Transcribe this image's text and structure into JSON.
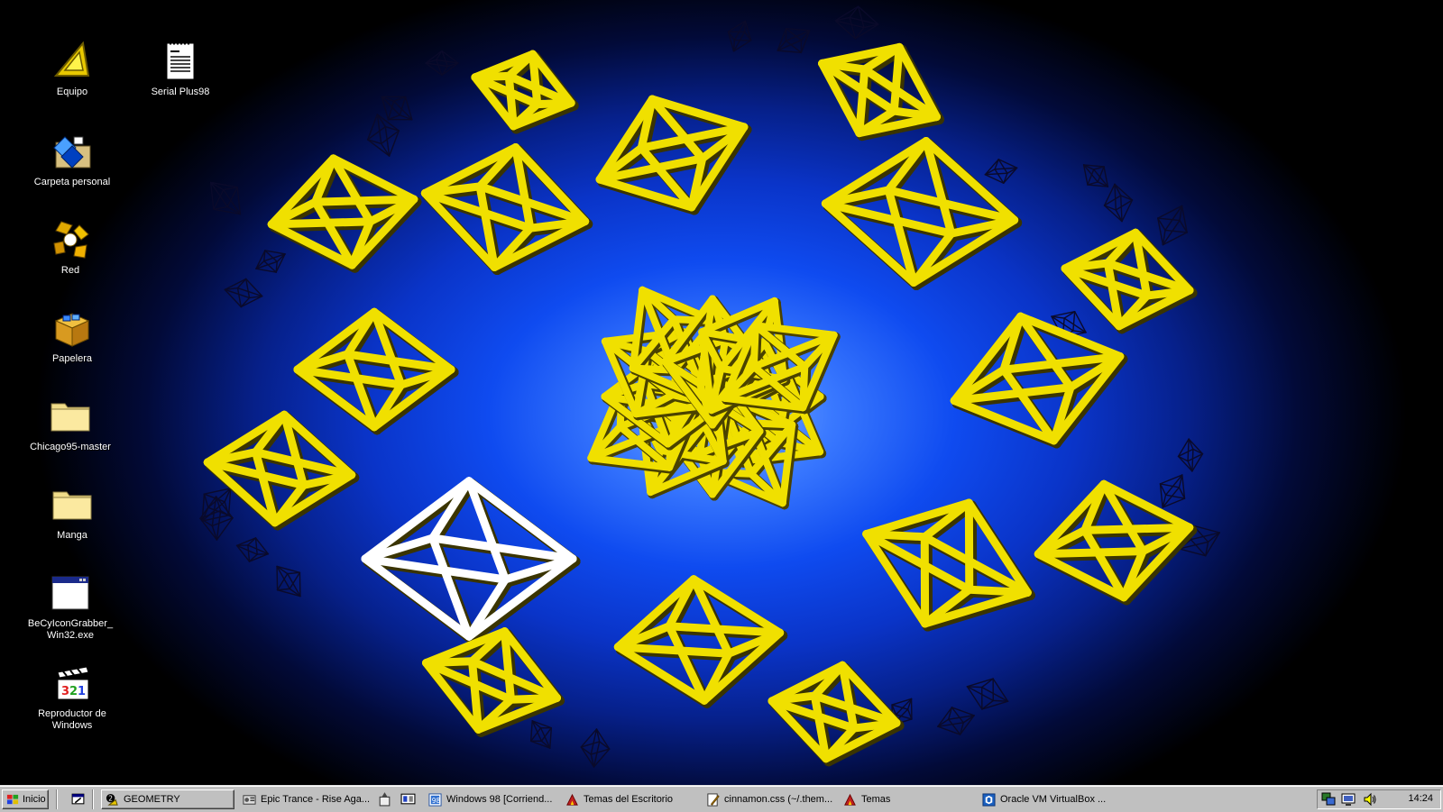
{
  "desktop": {
    "icons": [
      {
        "label": "Equipo",
        "icon": "computer-icon"
      },
      {
        "label": "Serial Plus98",
        "icon": "notepad-document-icon"
      },
      {
        "label": "Carpeta personal",
        "icon": "personal-folder-icon"
      },
      {
        "label": "Red",
        "icon": "network-icon"
      },
      {
        "label": "Papelera",
        "icon": "recycle-bin-icon"
      },
      {
        "label": "Chicago95-master",
        "icon": "folder-icon"
      },
      {
        "label": "Manga",
        "icon": "folder-icon"
      },
      {
        "label": "BeCyIconGrabber_ Win32.exe",
        "icon": "application-window-icon"
      },
      {
        "label": "Reproductor de Windows",
        "icon": "media-player-icon"
      }
    ],
    "wallpaper": "3D geometry screensaver"
  },
  "taskbar": {
    "start_label": "Inicio",
    "buttons": [
      {
        "label": "GEOMETRY",
        "icon": "screensaver-icon"
      },
      {
        "label": "Epic Trance - Rise Aga...",
        "icon": "media-icon"
      },
      {
        "label": "Windows 98 [Corriend...",
        "icon": "virtualbox-window-icon"
      },
      {
        "label": "Temas del Escritorio",
        "icon": "themes-icon"
      },
      {
        "label": "cinnamon.css (~/.them...",
        "icon": "text-editor-icon"
      },
      {
        "label": "Temas",
        "icon": "themes-icon"
      },
      {
        "label": "Oracle VM VirtualBox ...",
        "icon": "virtualbox-icon"
      }
    ],
    "clock": "14:24"
  },
  "colors": {
    "taskbar": "#c0c0c0",
    "accent": "#f0e000",
    "wallpaper_center": "#3a79ff"
  }
}
